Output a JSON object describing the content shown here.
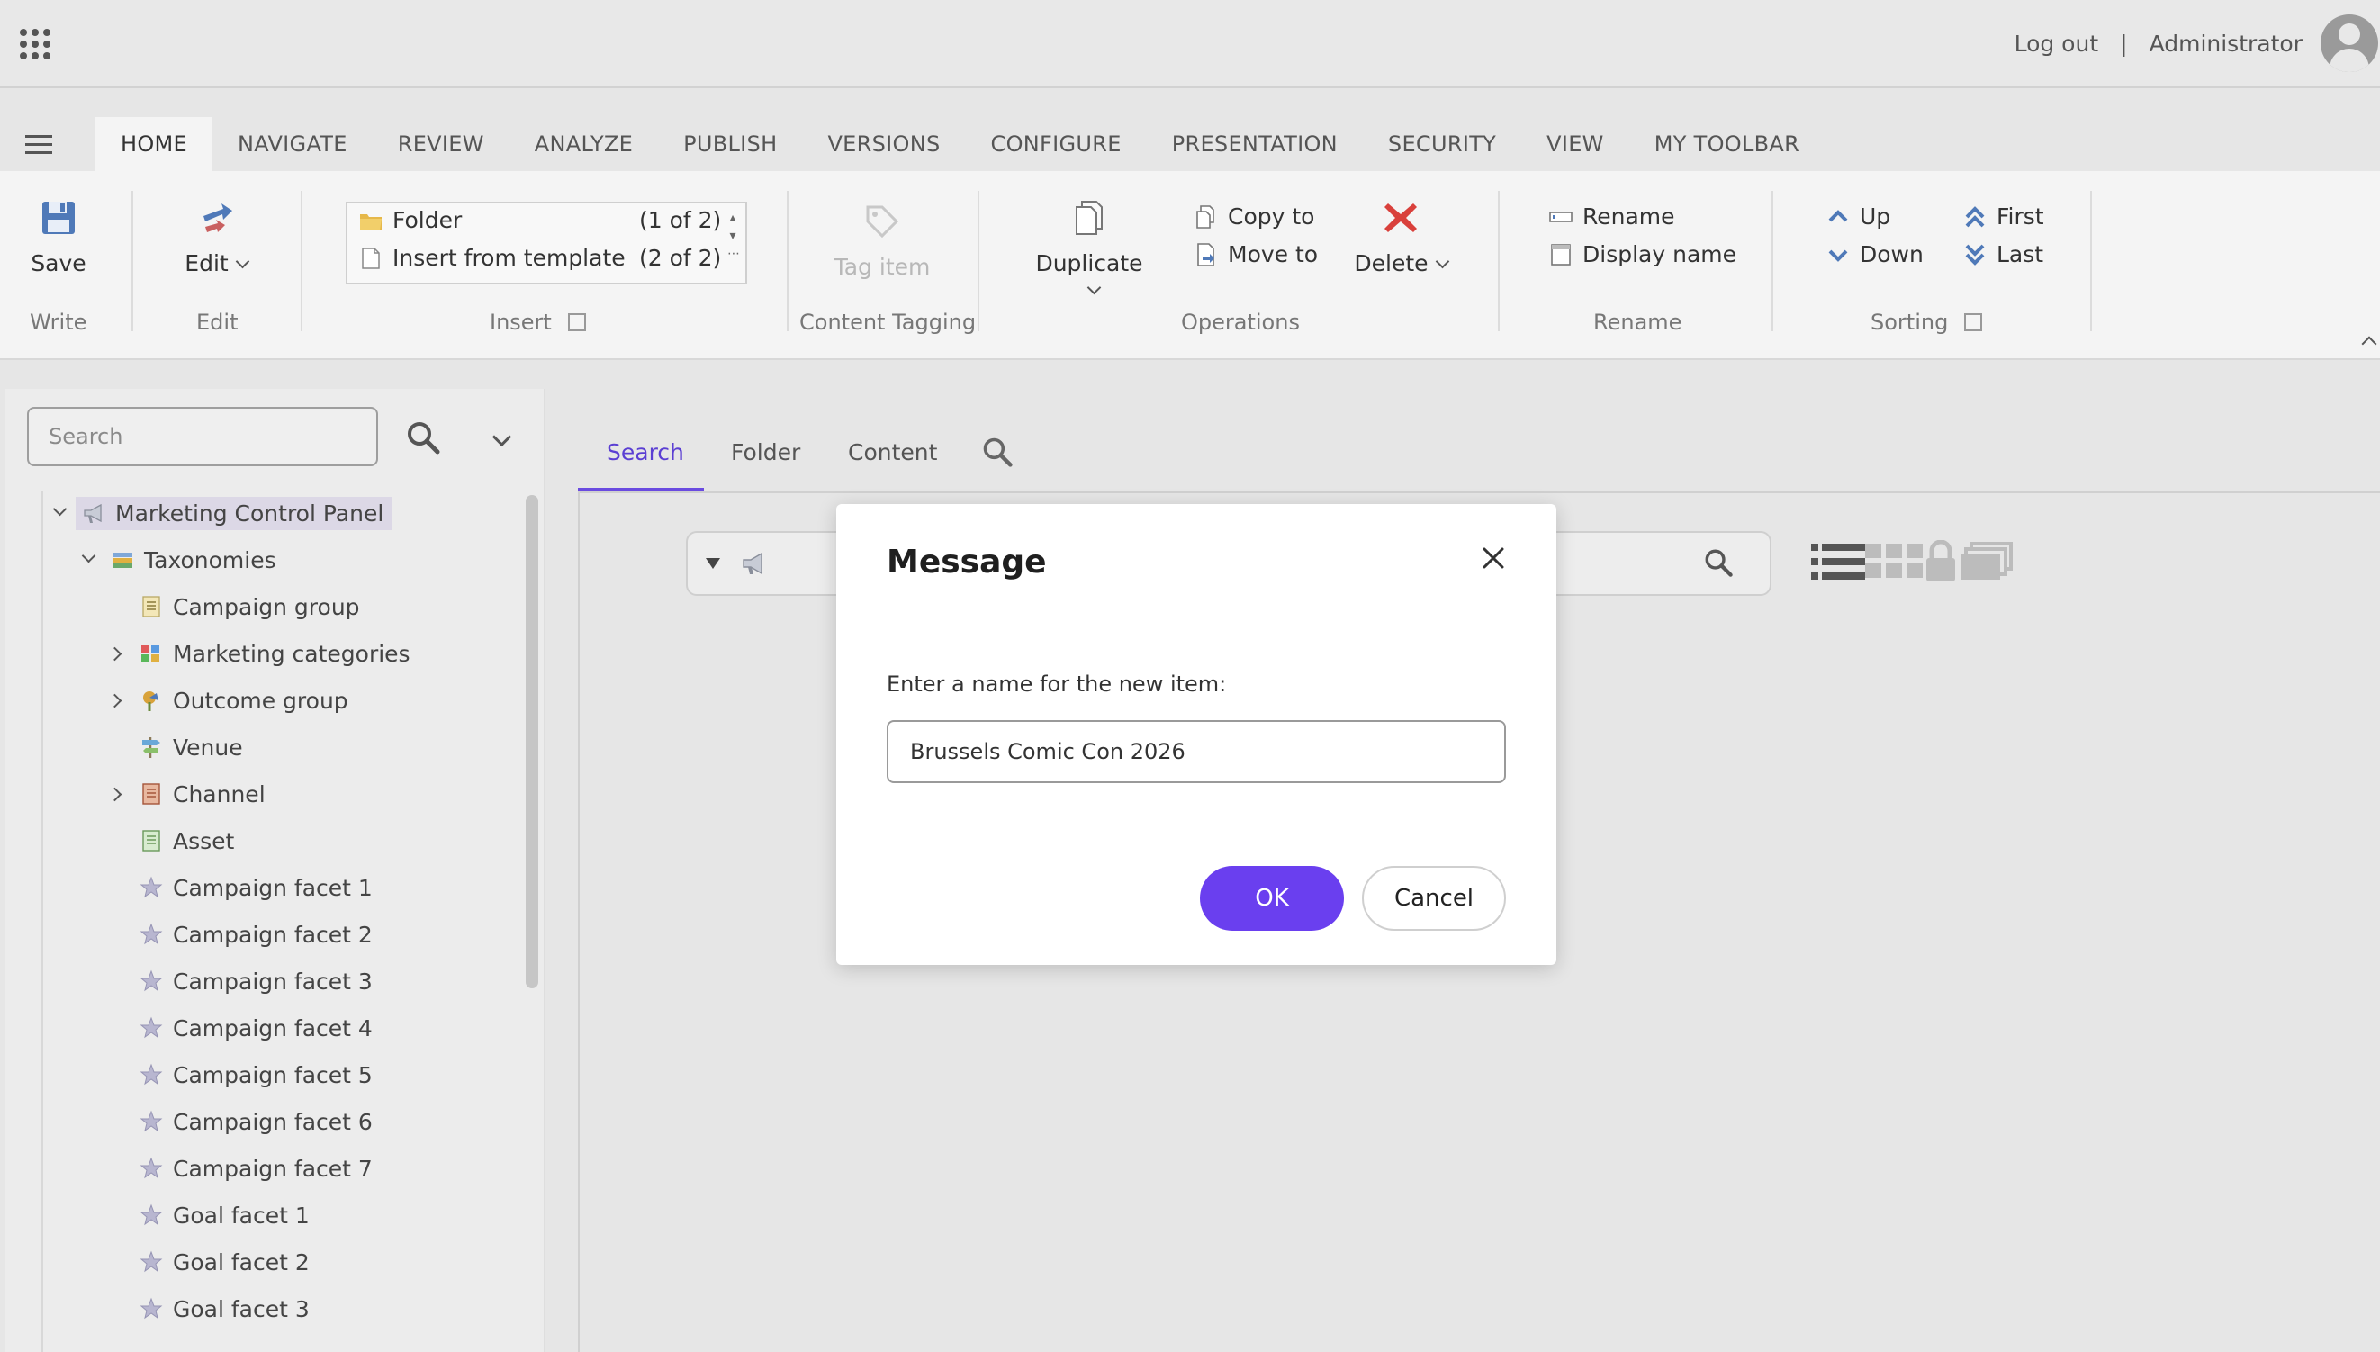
{
  "topbar": {
    "logout": "Log out",
    "separator": "|",
    "user": "Administrator"
  },
  "ribbon_tabs": [
    "HOME",
    "NAVIGATE",
    "REVIEW",
    "ANALYZE",
    "PUBLISH",
    "VERSIONS",
    "CONFIGURE",
    "PRESENTATION",
    "SECURITY",
    "VIEW",
    "MY TOOLBAR"
  ],
  "ribbon": {
    "write": {
      "title": "Write",
      "save": "Save"
    },
    "edit": {
      "title": "Edit",
      "edit": "Edit"
    },
    "insert": {
      "title": "Insert",
      "items": [
        {
          "label": "Folder",
          "count": "(1 of 2)"
        },
        {
          "label": "Insert from template",
          "count": "(2 of 2)"
        }
      ]
    },
    "tagging": {
      "title": "Content Tagging",
      "tag_item": "Tag item"
    },
    "operations": {
      "title": "Operations",
      "duplicate": "Duplicate",
      "copy_to": "Copy to",
      "move_to": "Move to",
      "delete": "Delete"
    },
    "rename": {
      "title": "Rename",
      "rename": "Rename",
      "display_name": "Display name"
    },
    "sorting": {
      "title": "Sorting",
      "up": "Up",
      "down": "Down",
      "first": "First",
      "last": "Last"
    }
  },
  "tree": {
    "search_placeholder": "Search",
    "items": [
      {
        "label": "Marketing Control Panel",
        "toggle": "open",
        "icon": "megaphone-icon"
      },
      {
        "label": "Taxonomies",
        "toggle": "open",
        "icon": "books-icon"
      },
      {
        "label": "Campaign group",
        "toggle": "none",
        "icon": "list-doc-icon"
      },
      {
        "label": "Marketing categories",
        "toggle": "closed",
        "icon": "cubes-icon"
      },
      {
        "label": "Outcome group",
        "toggle": "closed",
        "icon": "pin-icon"
      },
      {
        "label": "Venue",
        "toggle": "none",
        "icon": "signpost-icon"
      },
      {
        "label": "Channel",
        "toggle": "closed",
        "icon": "ledger-icon"
      },
      {
        "label": "Asset",
        "toggle": "none",
        "icon": "sheet-icon"
      },
      {
        "label": "Campaign facet 1",
        "toggle": "none",
        "icon": "star-icon"
      },
      {
        "label": "Campaign facet 2",
        "toggle": "none",
        "icon": "star-icon"
      },
      {
        "label": "Campaign facet 3",
        "toggle": "none",
        "icon": "star-icon"
      },
      {
        "label": "Campaign facet 4",
        "toggle": "none",
        "icon": "star-icon"
      },
      {
        "label": "Campaign facet 5",
        "toggle": "none",
        "icon": "star-icon"
      },
      {
        "label": "Campaign facet 6",
        "toggle": "none",
        "icon": "star-icon"
      },
      {
        "label": "Campaign facet 7",
        "toggle": "none",
        "icon": "star-icon"
      },
      {
        "label": "Goal facet 1",
        "toggle": "none",
        "icon": "star-icon"
      },
      {
        "label": "Goal facet 2",
        "toggle": "none",
        "icon": "star-icon"
      },
      {
        "label": "Goal facet 3",
        "toggle": "none",
        "icon": "star-icon"
      }
    ]
  },
  "content_tabs": [
    "Search",
    "Folder",
    "Content"
  ],
  "dialog": {
    "title": "Message",
    "label": "Enter a name for the new item:",
    "value": "Brussels Comic Con 2026",
    "ok": "OK",
    "cancel": "Cancel"
  },
  "colors": {
    "accent": "#6a3fef",
    "active_tab_text": "#5b3fd3"
  }
}
